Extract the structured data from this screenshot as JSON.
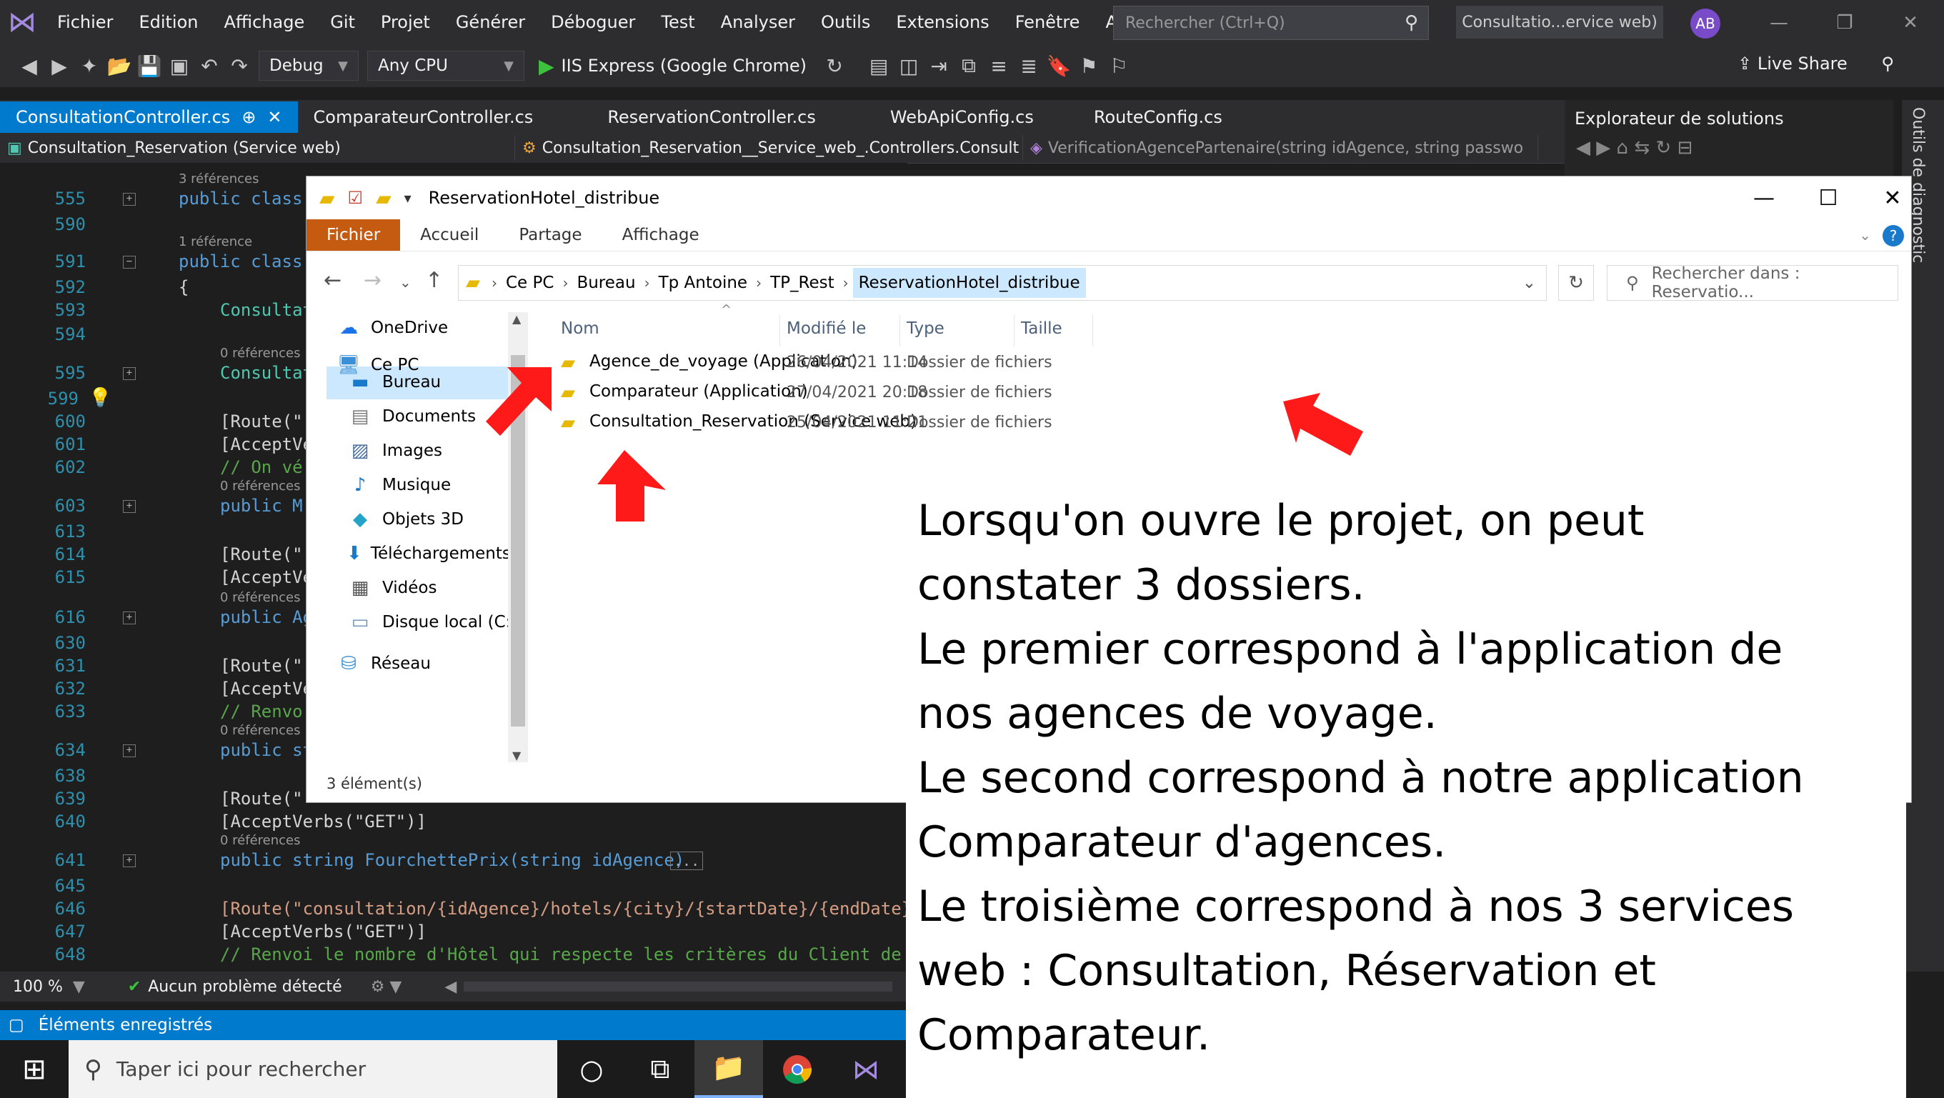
{
  "vs": {
    "menu": [
      "Fichier",
      "Edition",
      "Affichage",
      "Git",
      "Projet",
      "Générer",
      "Déboguer",
      "Test",
      "Analyser",
      "Outils",
      "Extensions",
      "Fenêtre",
      "Aide"
    ],
    "search_placeholder": "Rechercher (Ctrl+Q)",
    "solution_name": "Consultatio...ervice web)",
    "avatar": "AB",
    "config": "Debug",
    "platform": "Any CPU",
    "run_target": "IIS Express (Google Chrome)",
    "live_share": "Live Share",
    "tabs": [
      {
        "label": "ConsultationController.cs",
        "active": true
      },
      {
        "label": "ComparateurController.cs"
      },
      {
        "label": "ReservationController.cs"
      },
      {
        "label": "WebApiConfig.cs"
      },
      {
        "label": "RouteConfig.cs"
      }
    ],
    "nav": {
      "project": "Consultation_Reservation (Service web)",
      "class": "Consultation_Reservation__Service_web_.Controllers.Consult",
      "member": "VerificationAgencePartenaire(string idAgence, string passwo"
    },
    "solution_explorer_title": "Explorateur de solutions",
    "diagnostic_label": "Outils de diagnostic",
    "zoom": "100 %",
    "problems": "Aucun problème détecté",
    "status": "Éléments enregistrés"
  },
  "code": {
    "refs": {
      "r3": "3 références",
      "r1": "1 référence",
      "r0": "0 références"
    },
    "lines": [
      {
        "n": "555",
        "t": "public class"
      },
      {
        "n": "590",
        "t": ""
      },
      {
        "n": "591",
        "t": "public class"
      },
      {
        "n": "592",
        "t": "{"
      },
      {
        "n": "593",
        "t": "Consultat"
      },
      {
        "n": "594",
        "t": ""
      },
      {
        "n": "595",
        "t": "Consultat"
      },
      {
        "n": "599",
        "t": ""
      },
      {
        "n": "600",
        "t": "[Route(\""
      },
      {
        "n": "601",
        "t": "[AcceptVe"
      },
      {
        "n": "602",
        "t": "// On vé"
      },
      {
        "n": "603",
        "t": "public M"
      },
      {
        "n": "613",
        "t": ""
      },
      {
        "n": "614",
        "t": "[Route(\""
      },
      {
        "n": "615",
        "t": "[AcceptVe"
      },
      {
        "n": "616",
        "t": "public Ag"
      },
      {
        "n": "630",
        "t": ""
      },
      {
        "n": "631",
        "t": "[Route(\""
      },
      {
        "n": "632",
        "t": "[AcceptVe"
      },
      {
        "n": "633",
        "t": "// Renvo"
      },
      {
        "n": "634",
        "t": "public st"
      },
      {
        "n": "638",
        "t": ""
      },
      {
        "n": "639",
        "t": "[Route(\""
      },
      {
        "n": "640",
        "t": "[AcceptVerbs(\"GET\")]"
      },
      {
        "n": "641",
        "t": "public string FourchettePrix(string idAgence)"
      },
      {
        "n": "645",
        "t": ""
      },
      {
        "n": "646",
        "t": "[Route(\"consultation/{idAgence}/hotels/{city}/{startDate}/{endDate}/"
      },
      {
        "n": "647",
        "t": "[AcceptVerbs(\"GET\")]"
      },
      {
        "n": "648",
        "t": "// Renvoi le nombre d'Hôtel qui respecte les critères du Client de l"
      }
    ]
  },
  "explorer": {
    "title": "ReservationHotel_distribue",
    "ribbon": [
      "Fichier",
      "Accueil",
      "Partage",
      "Affichage"
    ],
    "breadcrumb": [
      "Ce PC",
      "Bureau",
      "Tp Antoine",
      "TP_Rest",
      "ReservationHotel_distribue"
    ],
    "search_placeholder": "Rechercher dans : Reservatio...",
    "nav": [
      "OneDrive",
      "Ce PC",
      "Bureau",
      "Documents",
      "Images",
      "Musique",
      "Objets 3D",
      "Téléchargements",
      "Vidéos",
      "Disque local (C:)",
      "Réseau"
    ],
    "columns": [
      "Nom",
      "Modifié le",
      "Type",
      "Taille"
    ],
    "files": [
      {
        "name": "Agence_de_voyage (Application)",
        "date": "26/04/2021 11:14",
        "type": "Dossier de fichiers"
      },
      {
        "name": "Comparateur (Application)",
        "date": "27/04/2021 20:18",
        "type": "Dossier de fichiers"
      },
      {
        "name": "Consultation_Reservation (Service web)",
        "date": "25/04/2021 11:21",
        "type": "Dossier de fichiers"
      }
    ],
    "status": "3 élément(s)"
  },
  "taskbar": {
    "search_placeholder": "Taper ici pour rechercher"
  },
  "note": [
    "Lorsqu'on ouvre le projet, on peut",
    "constater 3 dossiers.",
    "Le premier correspond à l'application de",
    "nos agences de voyage.",
    "Le second correspond à notre application",
    "Comparateur d'agences.",
    "Le troisième correspond à  nos 3 services",
    "web : Consultation, Réservation et",
    "Comparateur."
  ]
}
